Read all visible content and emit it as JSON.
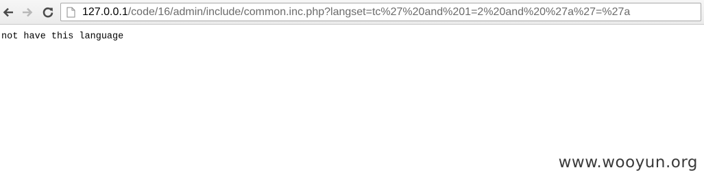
{
  "toolbar": {
    "back_icon": "back-arrow-icon",
    "forward_icon": "forward-arrow-icon",
    "reload_icon": "reload-icon",
    "page_icon": "page-icon",
    "url_host": "127.0.0.1",
    "url_path": "/code/16/admin/include/common.inc.php?langset=tc%27%20and%201=2%20and%20%27a%27=%27a",
    "colors": {
      "host": "#000000",
      "path": "#6b6b6b"
    }
  },
  "page": {
    "message": "not have this language"
  },
  "watermark": {
    "text": "www.wooyun.org"
  }
}
